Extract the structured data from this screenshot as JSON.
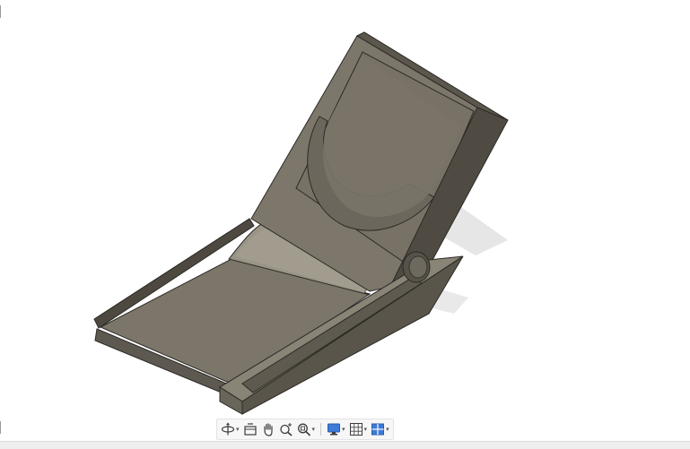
{
  "viewport": {
    "background": "#ffffff",
    "model": {
      "subject": "phone-stand-3d-model",
      "colors": {
        "body": "#7b7568",
        "body_light": "#8e887b",
        "body_dark": "#5a554b",
        "side": "#4e4a42",
        "edge": "#2b2a26",
        "shadow": "#e5e5e5"
      }
    }
  },
  "nav_toolbar": {
    "items": [
      {
        "name": "orbit-icon",
        "has_dropdown": true
      },
      {
        "name": "look-at-icon",
        "has_dropdown": false
      },
      {
        "name": "pan-icon",
        "has_dropdown": false
      },
      {
        "name": "zoom-icon",
        "has_dropdown": false
      },
      {
        "name": "fit-icon",
        "has_dropdown": true
      },
      {
        "name": "display-settings-icon",
        "has_dropdown": true
      },
      {
        "name": "grid-snaps-icon",
        "has_dropdown": true
      },
      {
        "name": "viewports-icon",
        "has_dropdown": true
      }
    ],
    "dropdown_glyph": "▾",
    "icon_color": "#3c3c3c",
    "accent_color": "#3d7bd9"
  }
}
